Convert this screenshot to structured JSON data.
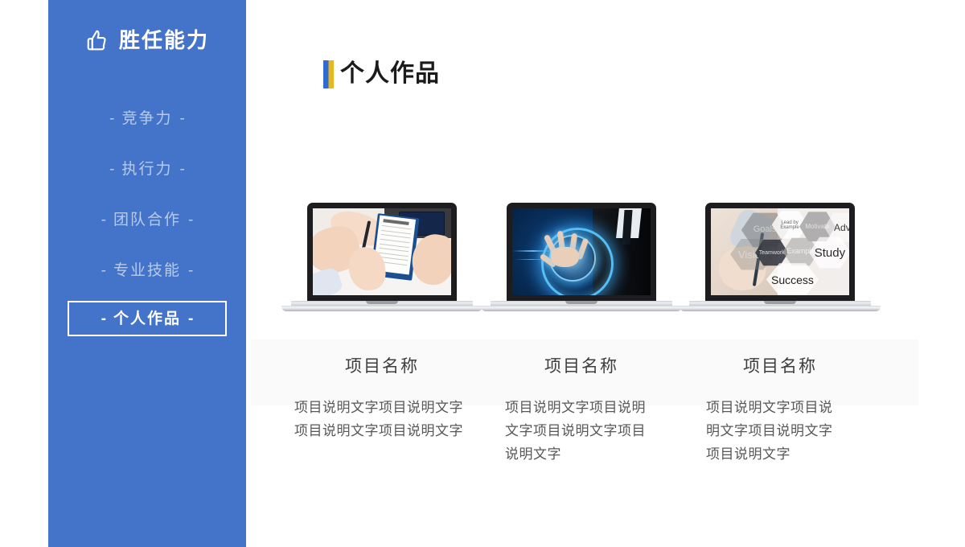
{
  "theme": {
    "sidebar_bg": "#4374c9",
    "accent_blue": "#2f6bd0",
    "accent_yellow": "#e8b81e",
    "band_bg": "#fafafa",
    "page_bg": "#ffffff"
  },
  "sidebar": {
    "brand_icon": "thumbs-up-icon",
    "brand_title": "胜任能力",
    "dash": "-",
    "items": [
      {
        "label": "竞争力",
        "active": false
      },
      {
        "label": "执行力",
        "active": false
      },
      {
        "label": "团队合作",
        "active": false
      },
      {
        "label": "专业技能",
        "active": false
      },
      {
        "label": "个人作品",
        "active": true
      }
    ]
  },
  "main": {
    "page_title": "个人作品",
    "projects": [
      {
        "image_name": "contract-signing-photo",
        "title": "项目名称",
        "description": "项目说明文字项目说明文字项目说明文字项目说明文字"
      },
      {
        "image_name": "tech-hand-interface-photo",
        "title": "项目名称",
        "description": "项目说明文字项目说明文字项目说明文字项目说明文字"
      },
      {
        "image_name": "hexagon-keywords-photo",
        "title": "项目名称",
        "description": "项目说明文字项目说明文字项目说明文字项目说明文字"
      }
    ],
    "hex_labels": [
      "Goals",
      "Lead by Example",
      "Motivate",
      "Adv",
      "Vision",
      "Teamwork",
      "Example",
      "Study",
      "Success"
    ]
  }
}
